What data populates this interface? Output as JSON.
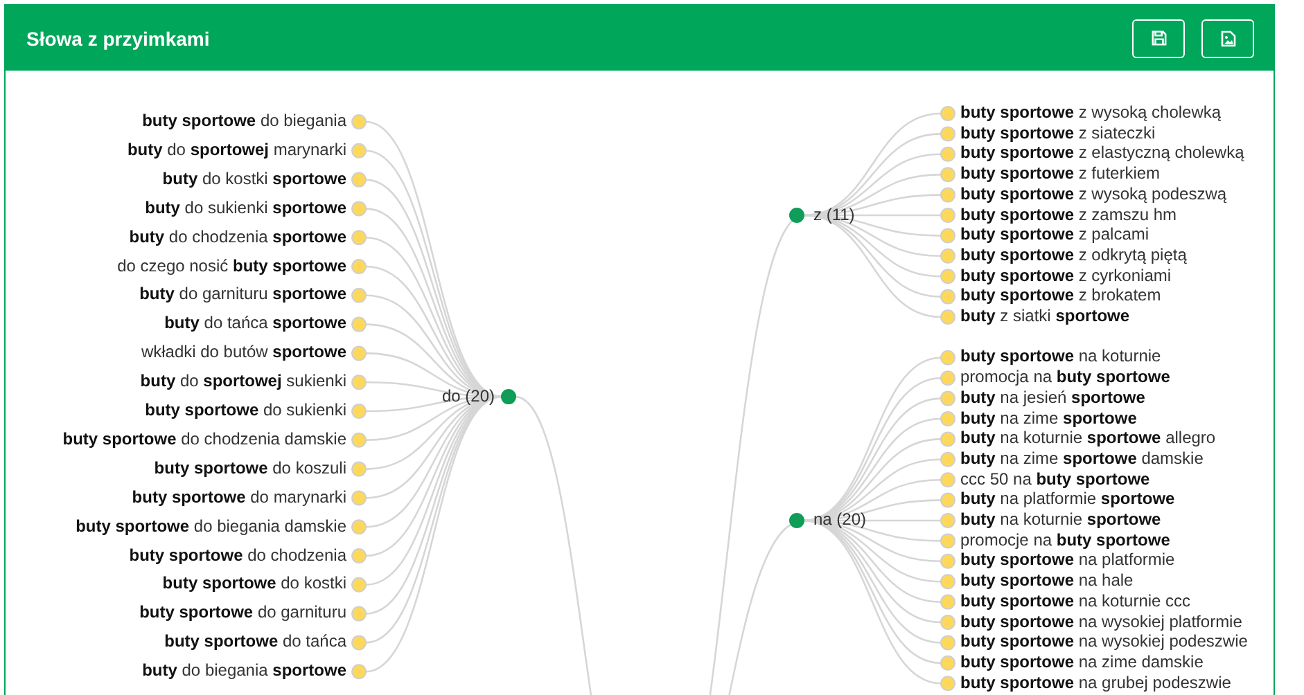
{
  "panel": {
    "title": "Słowa z przyimkami",
    "buttons": [
      {
        "kind": "save"
      },
      {
        "kind": "image"
      }
    ]
  },
  "tree": {
    "groups": [
      {
        "label": "do (20)",
        "kind": "left",
        "leaves": [
          "**buty sportowe** do biegania",
          "**buty** do **sportowej** marynarki",
          "**buty** do kostki **sportowe**",
          "**buty** do sukienki **sportowe**",
          "**buty** do chodzenia **sportowe**",
          "do czego nosić **buty sportowe**",
          "**buty** do garnituru **sportowe**",
          "**buty** do tańca **sportowe**",
          "wkładki do butów **sportowe**",
          "**buty** do **sportowej** sukienki",
          "**buty sportowe** do sukienki",
          "**buty sportowe** do chodzenia damskie",
          "**buty sportowe** do koszuli",
          "**buty sportowe** do marynarki",
          "**buty sportowe** do biegania damskie",
          "**buty sportowe** do chodzenia",
          "**buty sportowe** do kostki",
          "**buty sportowe** do garnituru",
          "**buty sportowe** do tańca",
          "**buty** do biegania **sportowe**"
        ]
      },
      {
        "label": "z (11)",
        "kind": "right",
        "leaves": [
          "**buty sportowe** z wysoką cholewką",
          "**buty sportowe** z siateczki",
          "**buty sportowe** z elastyczną cholewką",
          "**buty sportowe** z futerkiem",
          "**buty sportowe** z wysoką podeszwą",
          "**buty sportowe** z zamszu hm",
          "**buty sportowe** z palcami",
          "**buty sportowe** z odkrytą piętą",
          "**buty sportowe** z cyrkoniami",
          "**buty sportowe** z brokatem",
          "**buty** z siatki **sportowe**"
        ]
      },
      {
        "label": "na (20)",
        "kind": "right",
        "leaves": [
          "**buty sportowe** na koturnie",
          "promocja na **buty sportowe**",
          "**buty** na jesień **sportowe**",
          "**buty** na zime **sportowe**",
          "**buty** na koturnie **sportowe** allegro",
          "**buty** na zime **sportowe** damskie",
          "ccc 50 na **buty sportowe**",
          "**buty** na platformie **sportowe**",
          "**buty** na koturnie **sportowe**",
          "promocje na **buty sportowe**",
          "**buty sportowe** na platformie",
          "**buty sportowe** na hale",
          "**buty sportowe** na koturnie ccc",
          "**buty sportowe** na wysokiej platformie",
          "**buty sportowe** na wysokiej podeszwie",
          "**buty sportowe** na zime damskie",
          "**buty sportowe** na grubej podeszwie"
        ]
      }
    ]
  }
}
